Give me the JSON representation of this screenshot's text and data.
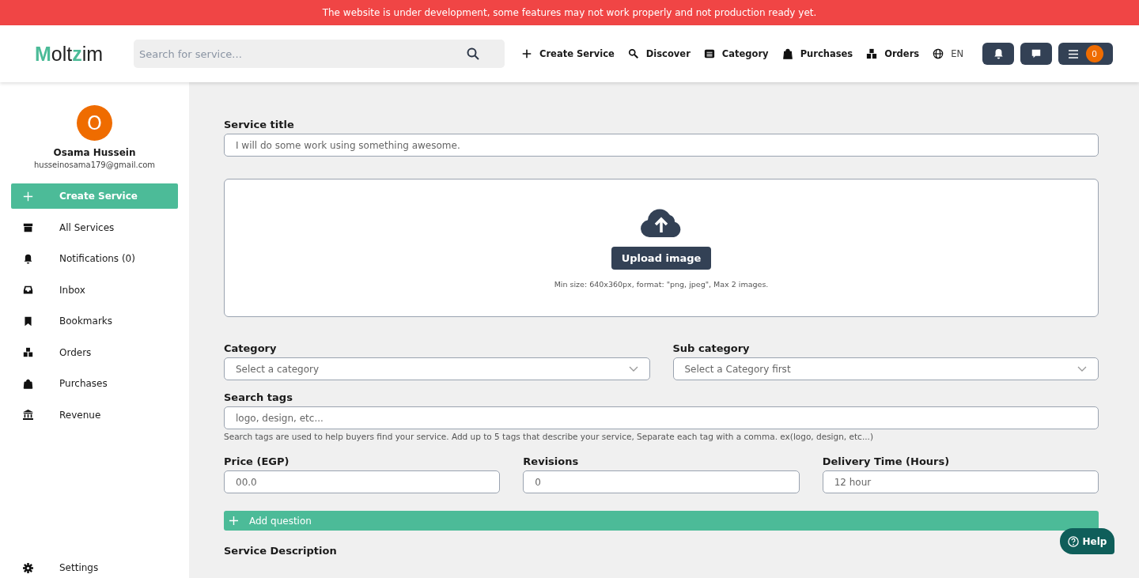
{
  "banner": {
    "text": "The website is under development, some features may not work properly and not production ready yet."
  },
  "header": {
    "logo": [
      {
        "text": "M",
        "accent": true
      },
      {
        "text": "olt",
        "accent": false
      },
      {
        "text": "z",
        "accent": true
      },
      {
        "text": "im",
        "accent": false
      }
    ],
    "search": {
      "placeholder": "Search for service..."
    },
    "nav": [
      {
        "kind": "plus",
        "label": "Create Service"
      },
      {
        "kind": "discover",
        "label": "Discover"
      },
      {
        "kind": "list",
        "label": "Category"
      },
      {
        "kind": "bag",
        "label": "Purchases"
      },
      {
        "kind": "boxes",
        "label": "Orders"
      },
      {
        "kind": "globe",
        "label": "EN"
      }
    ],
    "menu_badge": "0"
  },
  "sidebar": {
    "avatar": "O",
    "name": "Osama Hussein",
    "email": "husseinosama179@gmail.com",
    "items": [
      {
        "kind": "plus",
        "label": "Create Service",
        "selected": true
      },
      {
        "kind": "archive",
        "label": "All Services",
        "selected": false
      },
      {
        "kind": "bell",
        "label": "Notifications (0)",
        "selected": false
      },
      {
        "kind": "inbox",
        "label": "Inbox",
        "selected": false
      },
      {
        "kind": "bookmark",
        "label": "Bookmarks",
        "selected": false
      },
      {
        "kind": "boxes",
        "label": "Orders",
        "selected": false
      },
      {
        "kind": "bag",
        "label": "Purchases",
        "selected": false
      },
      {
        "kind": "bank",
        "label": "Revenue",
        "selected": false
      }
    ],
    "bottom_item": {
      "kind": "gear",
      "label": "Settings"
    }
  },
  "form": {
    "title": {
      "label": "Service title",
      "placeholder": "I will do some work using something awesome."
    },
    "upload": {
      "button": "Upload image",
      "hint": "Min size: 640x360px, format: \"png, jpeg\", Max 2 images."
    },
    "category": {
      "label": "Category",
      "placeholder": "Select a category"
    },
    "sub_category": {
      "label": "Sub category",
      "placeholder": "Select a Category first"
    },
    "tags": {
      "label": "Search tags",
      "placeholder": "logo, design, etc...",
      "hint": "Search tags are used to help buyers find your service. Add up to 5 tags that describe your service, Separate each tag with a comma. ex(logo, design, etc...)"
    },
    "numbers": [
      {
        "label": "Price (EGP)",
        "placeholder": "00.0"
      },
      {
        "label": "Revisions",
        "placeholder": "0"
      },
      {
        "label": "Delivery Time (Hours)",
        "placeholder": "12 hour"
      }
    ],
    "add_question": "Add question",
    "description_label": "Service Description"
  },
  "help": "Help"
}
